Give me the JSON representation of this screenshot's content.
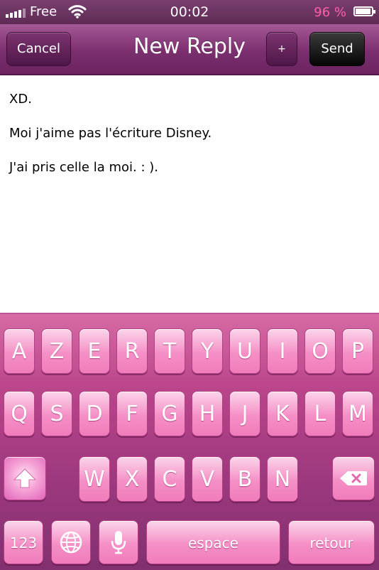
{
  "status_bar": {
    "carrier": "Free",
    "time": "00:02",
    "battery": "96 %",
    "battery_color": "#ff5fa8"
  },
  "nav": {
    "title": "New Reply",
    "cancel_label": "Cancel",
    "plus_label": "+",
    "send_label": "Send"
  },
  "message": {
    "lines": [
      "XD.",
      "Moi j'aime pas l'écriture Disney.",
      "J'ai pris celle la moi. : )."
    ]
  },
  "keyboard": {
    "row1": [
      "A",
      "Z",
      "E",
      "R",
      "T",
      "Y",
      "U",
      "I",
      "O",
      "P"
    ],
    "row2": [
      "Q",
      "S",
      "D",
      "F",
      "G",
      "H",
      "J",
      "K",
      "L",
      "M"
    ],
    "row3": [
      "W",
      "X",
      "C",
      "V",
      "B",
      "N"
    ],
    "numbers_label": "123",
    "space_label": "espace",
    "return_label": "retour",
    "key_color": "#f58fc6",
    "keyboard_color": "#a13a80"
  },
  "icons": {
    "signal": "signal-bars-icon",
    "wifi": "wifi-icon",
    "battery": "battery-charging-icon",
    "shift": "shift-arrow-icon",
    "delete": "backspace-icon",
    "globe": "globe-icon",
    "mic": "microphone-icon"
  }
}
